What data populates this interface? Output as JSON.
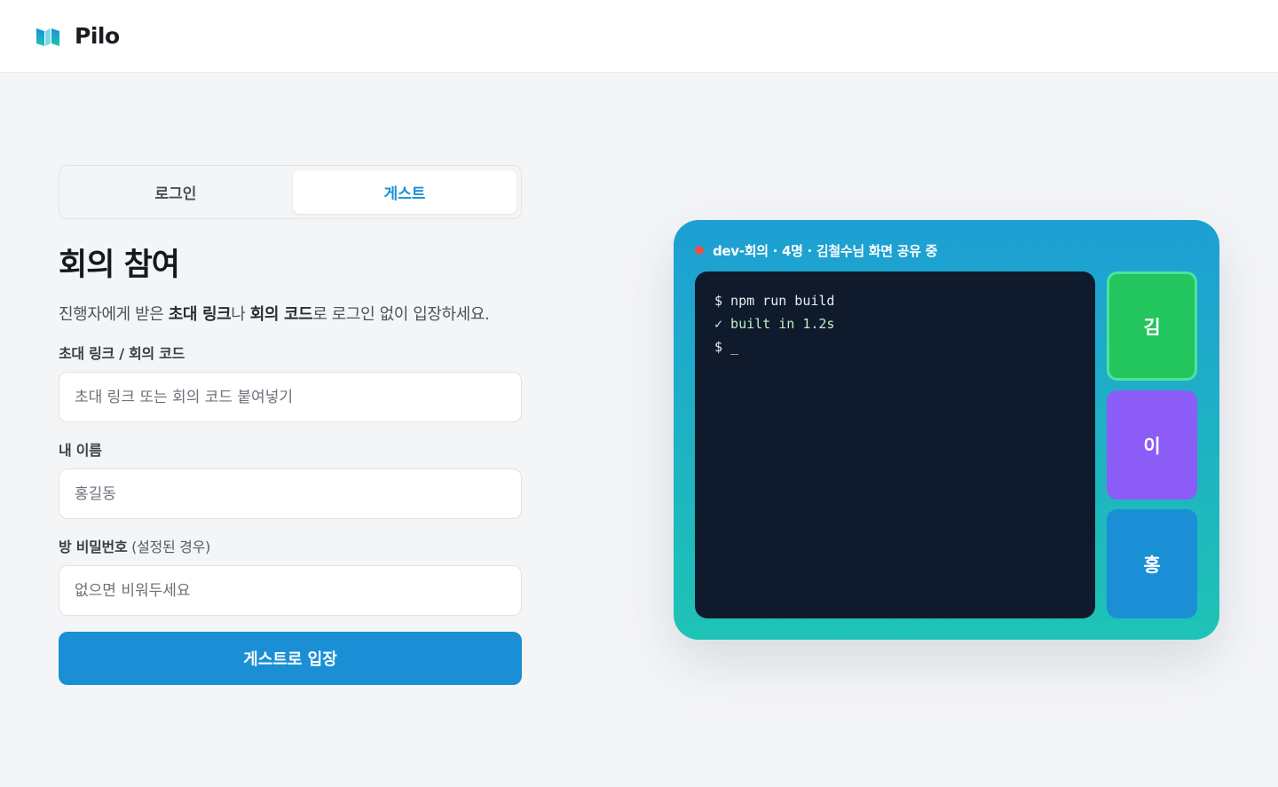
{
  "app": {
    "brand": "Pilo"
  },
  "tabs": [
    {
      "label": "로그인",
      "active": false
    },
    {
      "label": "게스트",
      "active": true
    }
  ],
  "form": {
    "title": "회의 참여",
    "desc_parts": [
      "진행자에게 받은 ",
      "초대 링크",
      "나 ",
      "회의 코드",
      "로 로그인 없이 입장하세요."
    ],
    "link_label": "초대 링크 / 회의 코드",
    "link_placeholder": "초대 링크 또는 회의 코드 붙여넣기",
    "name_label": "내 이름",
    "name_placeholder": "홍길동",
    "password_label": "방 비밀번호",
    "password_label_sub": " (설정된 경우)",
    "password_placeholder": "없으면 비워두세요",
    "submit_label": "게스트로 입장"
  },
  "preview": {
    "status": "dev-회의 · 4명 · 김철수님 화면 공유 중",
    "terminal": [
      "$ npm run build",
      "✓ built in 1.2s",
      "$ _"
    ],
    "participants": [
      {
        "initial": "김",
        "color": "#22c55e",
        "speaking": true
      },
      {
        "initial": "이",
        "color": "#8b5cf6",
        "speaking": false
      },
      {
        "initial": "홍",
        "color": "#1a8fd6",
        "speaking": false
      }
    ]
  },
  "colors": {
    "accent": "#1a8fd6",
    "live": "#e8504a",
    "terminal_bg": "#0f1b2c"
  }
}
